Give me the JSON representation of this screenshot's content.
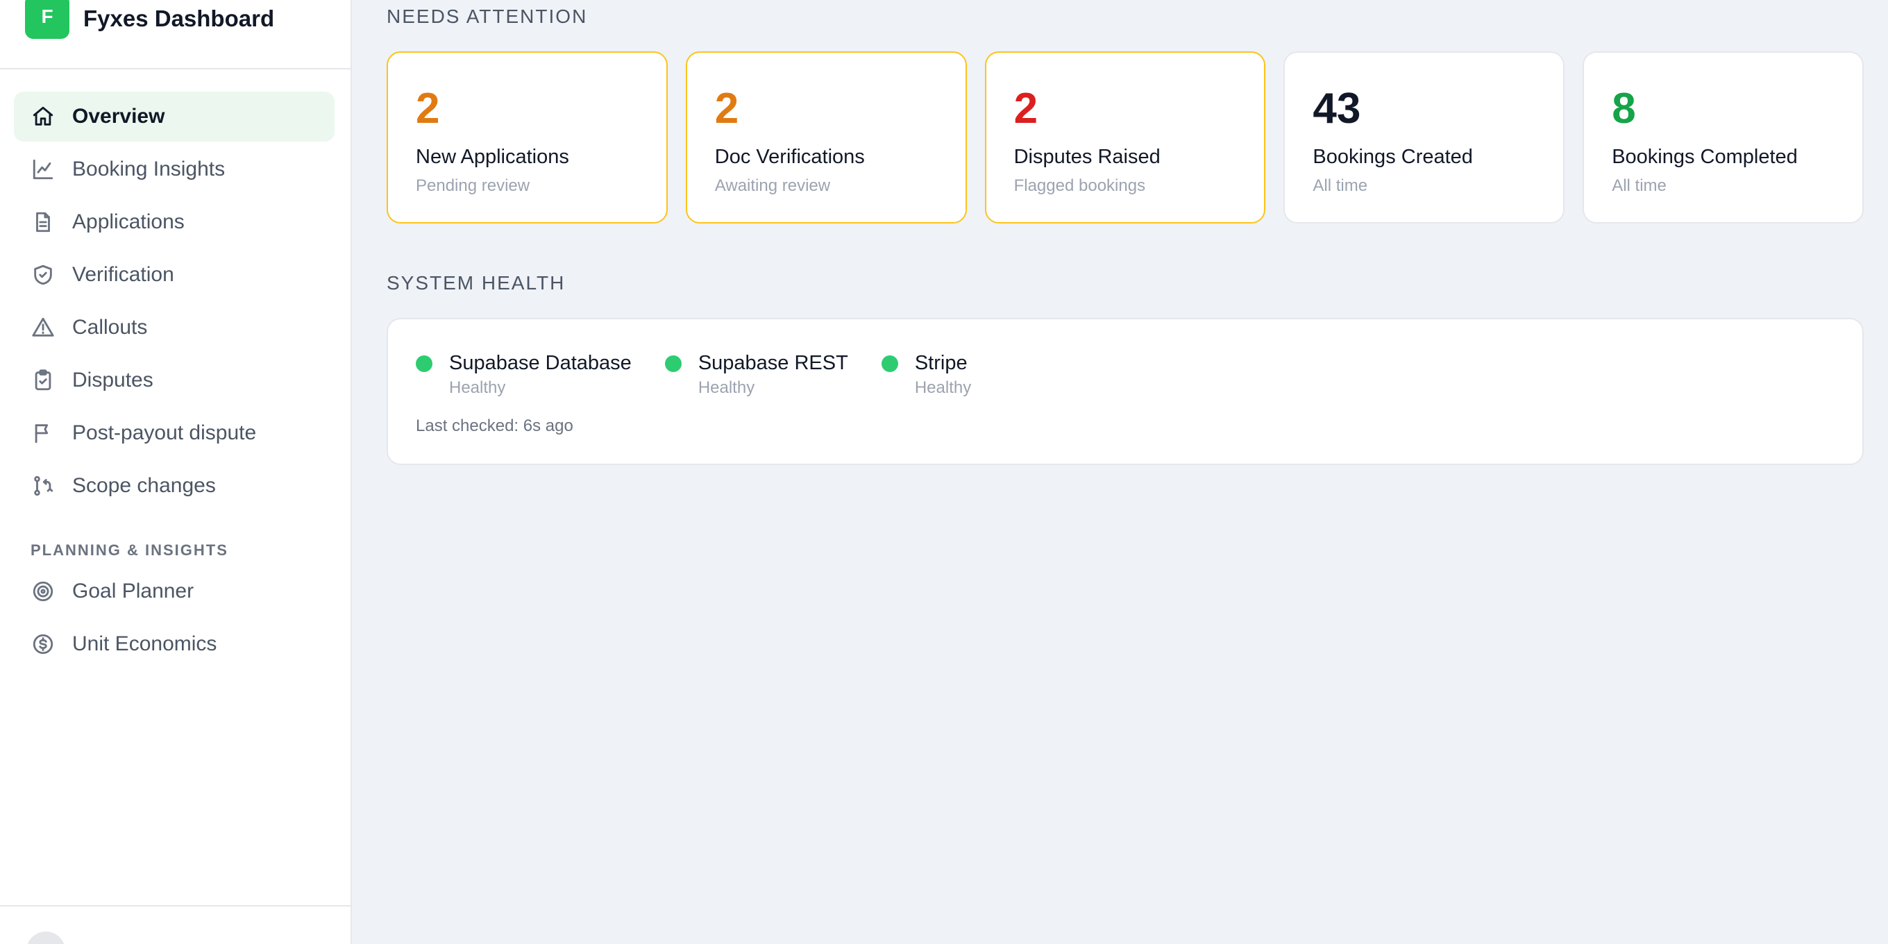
{
  "brand": {
    "logo_letter": "F",
    "title": "Fyxes Dashboard",
    "accent": "#22c55e"
  },
  "nav": {
    "items": [
      {
        "label": "Overview",
        "icon": "home-icon",
        "active": true
      },
      {
        "label": "Booking Insights",
        "icon": "chart-line-icon"
      },
      {
        "label": "Applications",
        "icon": "file-text-icon"
      },
      {
        "label": "Verification",
        "icon": "shield-check-icon"
      },
      {
        "label": "Callouts",
        "icon": "alert-triangle-icon"
      },
      {
        "label": "Disputes",
        "icon": "clipboard-check-icon"
      },
      {
        "label": "Post-payout dispute",
        "icon": "flag-icon"
      },
      {
        "label": "Scope changes",
        "icon": "git-compare-icon"
      }
    ],
    "section_label": "PLANNING & INSIGHTS",
    "section_items": [
      {
        "label": "Goal Planner",
        "icon": "target-icon"
      },
      {
        "label": "Unit Economics",
        "icon": "dollar-circle-icon"
      }
    ]
  },
  "needs_attention": {
    "title": "NEEDS ATTENTION",
    "cards": [
      {
        "value": "2",
        "label": "New Applications",
        "sub": "Pending review",
        "color": "#e07b12",
        "highlight": true
      },
      {
        "value": "2",
        "label": "Doc Verifications",
        "sub": "Awaiting review",
        "color": "#e07b12",
        "highlight": true
      },
      {
        "value": "2",
        "label": "Disputes Raised",
        "sub": "Flagged bookings",
        "color": "#dc1f1f",
        "highlight": true
      },
      {
        "value": "43",
        "label": "Bookings Created",
        "sub": "All time",
        "color": "#111827",
        "highlight": false
      },
      {
        "value": "8",
        "label": "Bookings Completed",
        "sub": "All time",
        "color": "#16a34a",
        "highlight": false
      }
    ]
  },
  "system_health": {
    "title": "SYSTEM HEALTH",
    "services": [
      {
        "name": "Supabase Database",
        "status": "Healthy",
        "color": "#2ecc71"
      },
      {
        "name": "Supabase REST",
        "status": "Healthy",
        "color": "#2ecc71"
      },
      {
        "name": "Stripe",
        "status": "Healthy",
        "color": "#2ecc71"
      }
    ],
    "last_checked": "Last checked: 6s ago"
  }
}
